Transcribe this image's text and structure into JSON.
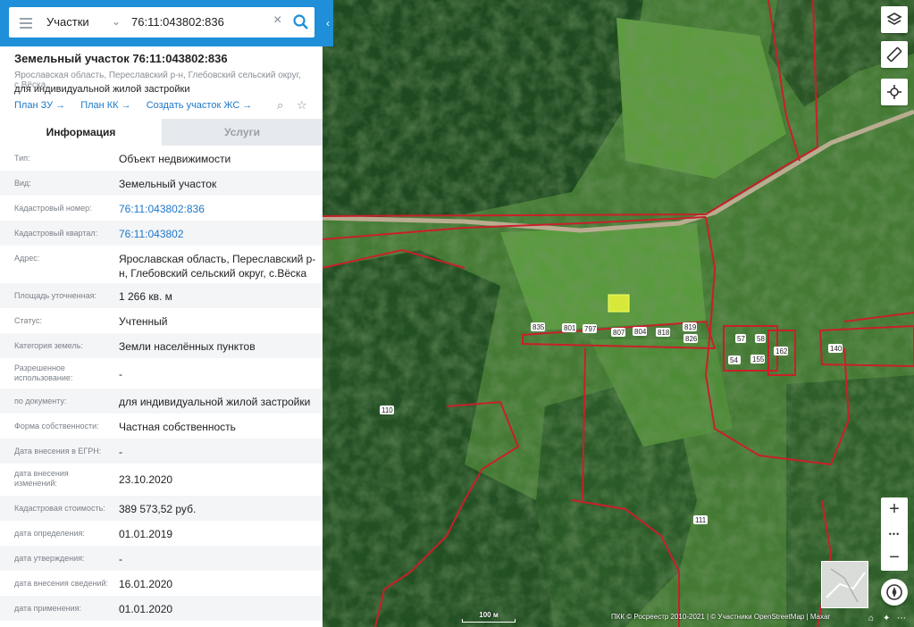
{
  "search": {
    "type": "Участки",
    "query": "76:11:043802:836"
  },
  "object": {
    "title": "Земельный участок 76:11:043802:836",
    "address": "Ярославская область, Переславский р-н, Глебовский сельский округ, с.Вёска",
    "use": "для индивидуальной жилой застройки",
    "links": [
      "План ЗУ →",
      "План КК →",
      "Создать участок ЖС →"
    ]
  },
  "tabs": {
    "info": "Информация",
    "services": "Услуги"
  },
  "rows": [
    {
      "label": "Тип:",
      "value": "Объект недвижимости"
    },
    {
      "label": "Вид:",
      "value": "Земельный участок"
    },
    {
      "label": "Кадастровый номер:",
      "value": "76:11:043802:836",
      "link": true
    },
    {
      "label": "Кадастровый квартал:",
      "value": "76:11:043802",
      "link": true
    },
    {
      "label": "Адрес:",
      "value": "Ярославская область, Переславский р-н, Глебовский сельский округ, с.Вёска"
    },
    {
      "label": "Площадь уточненная:",
      "value": "1 266 кв. м"
    },
    {
      "label": "Статус:",
      "value": "Учтенный"
    },
    {
      "label": "Категория земель:",
      "value": "Земли населённых пунктов"
    },
    {
      "label": "Разрешенное использование:",
      "value": "-"
    },
    {
      "label": "по документу:",
      "value": "для индивидуальной жилой застройки"
    },
    {
      "label": "Форма собственности:",
      "value": "Частная собственность"
    },
    {
      "label": "Дата внесения в ЕГРН:",
      "value": "-"
    },
    {
      "label": "дата внесения изменений:",
      "value": "23.10.2020"
    },
    {
      "label": "Кадастровая стоимость:",
      "value": "389 573,52 руб."
    },
    {
      "label": "дата определения:",
      "value": "01.01.2019"
    },
    {
      "label": "дата утверждения:",
      "value": "-"
    },
    {
      "label": "дата внесения сведений:",
      "value": "16.01.2020"
    },
    {
      "label": "дата применения:",
      "value": "01.01.2020"
    }
  ],
  "map": {
    "parcel_labels": [
      "835",
      "801",
      "797",
      "807",
      "804",
      "818",
      "819",
      "826",
      "57",
      "58",
      "54",
      "155",
      "162",
      "140",
      "110",
      "111"
    ],
    "scale": "100 м",
    "attribution": "ПКК © Росреестр 2010-2021 | © Участники OpenStreetMap | Maxar",
    "colors": {
      "boundary": "#c8202a",
      "accent": "#1e8fd8",
      "selected": "#d7e83a"
    }
  },
  "icons": {
    "menu": "menu-icon",
    "chevron": "chevron-down-icon",
    "clear": "close-icon",
    "search": "search-icon",
    "layers": "layers-icon",
    "ruler": "ruler-icon",
    "locate": "crosshair-icon",
    "compass": "compass-icon"
  },
  "zoom": {
    "plus": "+",
    "more": "•••",
    "minus": "−"
  }
}
